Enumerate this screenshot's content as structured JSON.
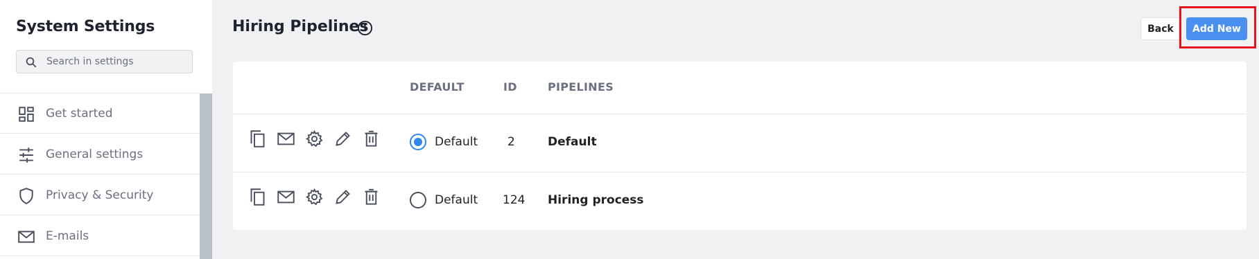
{
  "sidebar": {
    "title": "System Settings",
    "search": {
      "placeholder": "Search in settings",
      "value": ""
    },
    "items": [
      {
        "label": "Get started",
        "icon": "dashboard-icon"
      },
      {
        "label": "General settings",
        "icon": "sliders-icon"
      },
      {
        "label": "Privacy & Security",
        "icon": "shield-icon"
      },
      {
        "label": "E-mails",
        "icon": "mail-icon"
      }
    ]
  },
  "header": {
    "title": "Hiring Pipelines",
    "back_label": "Back",
    "add_new_label": "Add New"
  },
  "table": {
    "columns": {
      "default": "DEFAULT",
      "id": "ID",
      "pipelines": "PIPELINES"
    },
    "rows": [
      {
        "default_label": "Default",
        "is_default": true,
        "id": "2",
        "pipeline": "Default"
      },
      {
        "default_label": "Default",
        "is_default": false,
        "id": "124",
        "pipeline": "Hiring process"
      }
    ],
    "row_actions": [
      "copy-icon",
      "mail-icon",
      "gear-icon",
      "pencil-icon",
      "trash-icon"
    ]
  },
  "colors": {
    "accent": "#4a90f0",
    "radio_selected": "#2f86f0",
    "highlight": "#e8141b",
    "muted_text": "#6b7080"
  }
}
